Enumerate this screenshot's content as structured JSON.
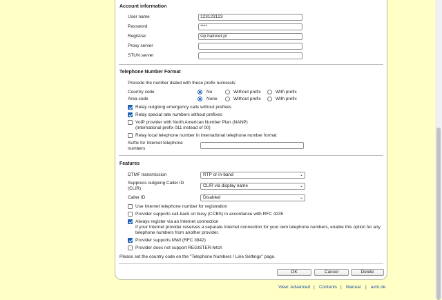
{
  "account": {
    "heading": "Account information",
    "fields": [
      {
        "label": "User name",
        "value": "123123123"
      },
      {
        "label": "Password",
        "value": "****"
      },
      {
        "label": "Registrar",
        "value": "sip.halonet.pl"
      },
      {
        "label": "Proxy server",
        "value": ""
      },
      {
        "label": "STUN server",
        "value": ""
      }
    ]
  },
  "format": {
    "heading": "Telephone Number Format",
    "intro": "Precede the number dialed with these prefix numerals:",
    "country_code": {
      "label": "Country code",
      "options": [
        "No",
        "Without prefix",
        "With prefix"
      ],
      "selected": "No"
    },
    "area_code": {
      "label": "Area code",
      "options": [
        "None",
        "Without prefix",
        "With prefix"
      ],
      "selected": "None"
    },
    "checks": [
      {
        "label": "Relay outgoing emergency calls without prefixes",
        "checked": true
      },
      {
        "label": "Relay special rate numbers without prefixes",
        "checked": true
      },
      {
        "label": "VoIP provider with North American Number Plan (NANP)",
        "sub": "(international prefix 011 instead of 00)",
        "checked": false
      },
      {
        "label": "Relay local telephone number in international telephone number format",
        "checked": false
      }
    ],
    "suffix_label_1": "Suffix for Internet telephone",
    "suffix_label_2": "numbers",
    "suffix_value": ""
  },
  "features": {
    "heading": "Features",
    "dtmf_label": "DTMF transmission",
    "dtmf_value": "RTP or in-band",
    "suppress_label_1": "Suppress outgoing Caller ID",
    "suppress_label_2": "(CLIR)",
    "suppress_value": "CLIR via display name",
    "callerid_label": "Caller ID",
    "callerid_value": "Disabled",
    "checks": [
      {
        "label": "Use Internet telephone number for registration",
        "checked": false
      },
      {
        "label": "Provider supports call-back on busy (CCBS) in accordance with RFC 4235",
        "checked": false
      },
      {
        "label": "Always register via an Internet connection",
        "checked": true
      },
      {
        "label": "Provider supports MWI (RFC 3842)",
        "checked": true
      },
      {
        "label": "Provider does not support REGISTER-fetch",
        "checked": false
      }
    ],
    "always_note_1": "If your Internet provider reserves a separate Internet connection for your own telephone numbers, enable this option for any",
    "always_note_2": "telephone numbers from another provider.",
    "country_note": "Please set the country code on the \"Telephone Numbers / Line Settings\" page."
  },
  "buttons": {
    "ok": "OK",
    "cancel": "Cancel",
    "delete": "Delete"
  },
  "footer": {
    "view": "View: Advanced",
    "contents": "Contents",
    "manual": "Manual",
    "site": "avm.de",
    "separator": "|"
  }
}
